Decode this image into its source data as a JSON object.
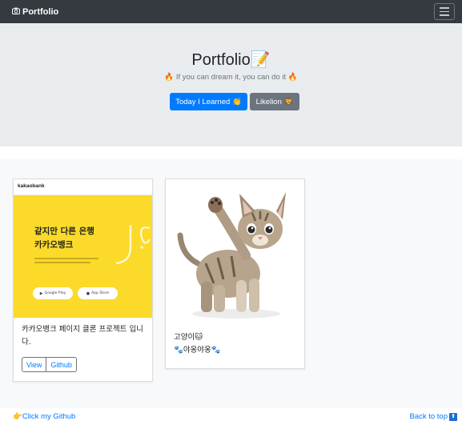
{
  "navbar": {
    "brand_icon": "camera-icon",
    "brand": "Portfolio",
    "toggle_icon": "hamburger-menu-icon"
  },
  "hero": {
    "title": "Portfolio📝",
    "subtitle": "🔥 If you can dream it, you can do it 🔥",
    "primary_button": "Today I Learned 👏",
    "secondary_button": "Likelion 🦁"
  },
  "cards": [
    {
      "image": {
        "logo": "kakaobank",
        "headline_line1": "같지만 다른 은행",
        "headline_line2": "카카오뱅크",
        "store_badge_1": "Google Play",
        "store_badge_2": "App Store"
      },
      "text": "카카오뱅크 페이지 클론 프로젝트 입니다.",
      "buttons": [
        "View",
        "Github"
      ]
    },
    {
      "image": {
        "alt": "kitten"
      },
      "text_line1": "고양이🐱",
      "text_line2": "🐾야옹야옹🐾"
    }
  ],
  "footer": {
    "left_link": "👉Click my Github",
    "right_link": "Back to top",
    "right_icon": "arrow-up-icon"
  },
  "colors": {
    "navbar": "#343a40",
    "hero": "#e9ecef",
    "primary": "#007bff",
    "secondary": "#6c757d",
    "kakao_yellow": "#fbda2a"
  }
}
